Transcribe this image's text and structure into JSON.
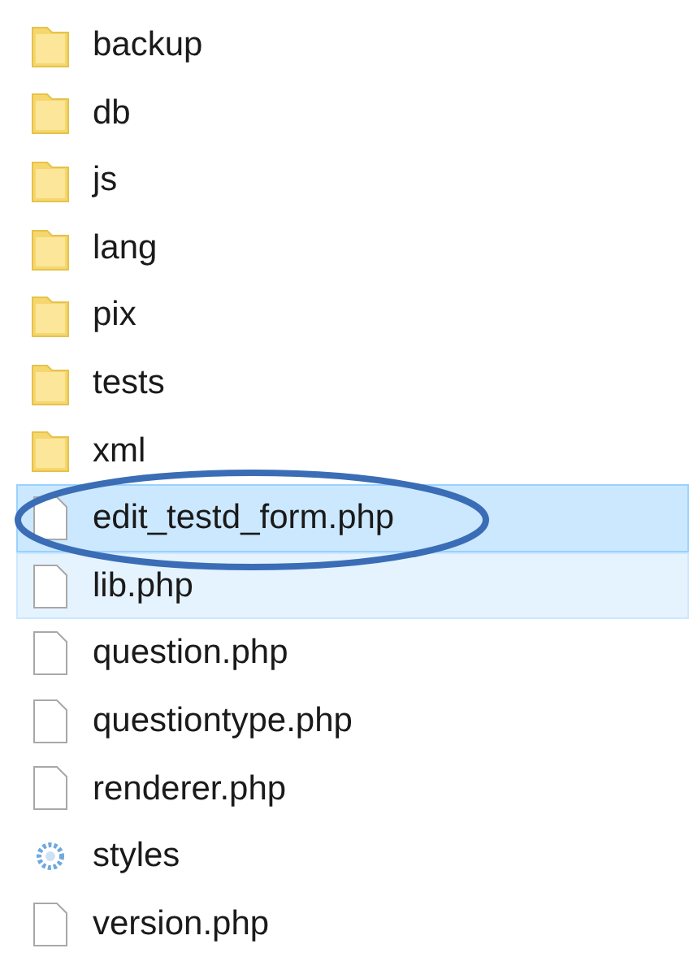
{
  "files": [
    {
      "name": "backup",
      "kind": "folder",
      "selected": false,
      "hover": false
    },
    {
      "name": "db",
      "kind": "folder",
      "selected": false,
      "hover": false
    },
    {
      "name": "js",
      "kind": "folder",
      "selected": false,
      "hover": false
    },
    {
      "name": "lang",
      "kind": "folder",
      "selected": false,
      "hover": false
    },
    {
      "name": "pix",
      "kind": "folder",
      "selected": false,
      "hover": false
    },
    {
      "name": "tests",
      "kind": "folder",
      "selected": false,
      "hover": false
    },
    {
      "name": "xml",
      "kind": "folder",
      "selected": false,
      "hover": false
    },
    {
      "name": "edit_testd_form.php",
      "kind": "file",
      "selected": true,
      "hover": false
    },
    {
      "name": "lib.php",
      "kind": "file",
      "selected": false,
      "hover": true
    },
    {
      "name": "question.php",
      "kind": "file",
      "selected": false,
      "hover": false
    },
    {
      "name": "questiontype.php",
      "kind": "file",
      "selected": false,
      "hover": false
    },
    {
      "name": "renderer.php",
      "kind": "file",
      "selected": false,
      "hover": false
    },
    {
      "name": "styles",
      "kind": "stylesheet",
      "selected": false,
      "hover": false
    },
    {
      "name": "version.php",
      "kind": "file",
      "selected": false,
      "hover": false
    }
  ]
}
